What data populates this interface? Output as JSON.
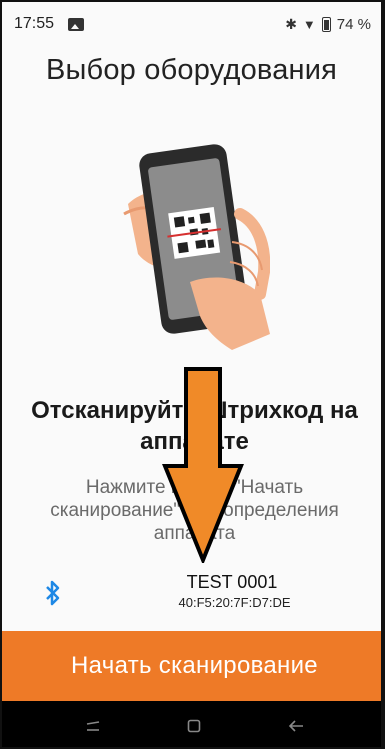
{
  "status_bar": {
    "time": "17:55",
    "battery_percent": "74 %",
    "icons": [
      "gallery-icon",
      "bluetooth-icon",
      "wifi-icon",
      "battery-icon"
    ]
  },
  "title": "Выбор оборудования",
  "illustration": {
    "icon": "phone-scanning-qr-icon"
  },
  "instruction": {
    "heading": "Отсканируйте Штрихкод на аппарате",
    "description": "Нажмите кнопку \"Начать сканирование\" для определения аппарата"
  },
  "device": {
    "icon": "bluetooth-icon",
    "name": "TEST 0001",
    "mac": "40:F5:20:7F:D7:DE"
  },
  "scan_button": {
    "label": "Начать сканирование"
  },
  "nav_bar": {
    "icons": [
      "recents-icon",
      "home-icon",
      "back-icon"
    ]
  },
  "overlay": {
    "icon": "down-arrow-icon"
  },
  "colors": {
    "accent": "#ee7a27",
    "bluetooth": "#1e88e5",
    "background": "#fafafa",
    "navbar": "#000000"
  }
}
